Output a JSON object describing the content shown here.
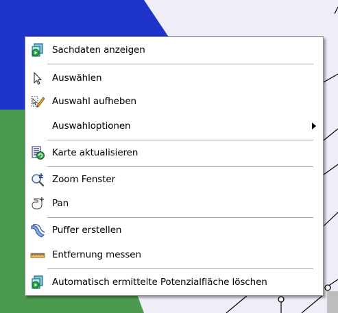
{
  "menu": {
    "items": [
      {
        "label": "Sachdaten anzeigen",
        "icon": "show-attributes-icon"
      },
      {
        "label": "Auswählen",
        "icon": "select-cursor-icon"
      },
      {
        "label": "Auswahl aufheben",
        "icon": "clear-selection-icon"
      },
      {
        "label": "Auswahloptionen",
        "icon": "",
        "submenu": true
      },
      {
        "label": "Karte aktualisieren",
        "icon": "refresh-map-icon"
      },
      {
        "label": "Zoom Fenster",
        "icon": "zoom-window-icon"
      },
      {
        "label": "Pan",
        "icon": "pan-hand-icon"
      },
      {
        "label": "Puffer erstellen",
        "icon": "buffer-icon"
      },
      {
        "label": "Entfernung messen",
        "icon": "measure-ruler-icon"
      },
      {
        "label": "Automatisch ermittelte Potenzialfläche löschen",
        "icon": "delete-area-icon"
      }
    ]
  },
  "colors": {
    "map_background": "#efedf7",
    "map_blue_area": "#1e33c9",
    "map_green_area": "#4b9a4f",
    "menu_background": "#ffffff"
  }
}
